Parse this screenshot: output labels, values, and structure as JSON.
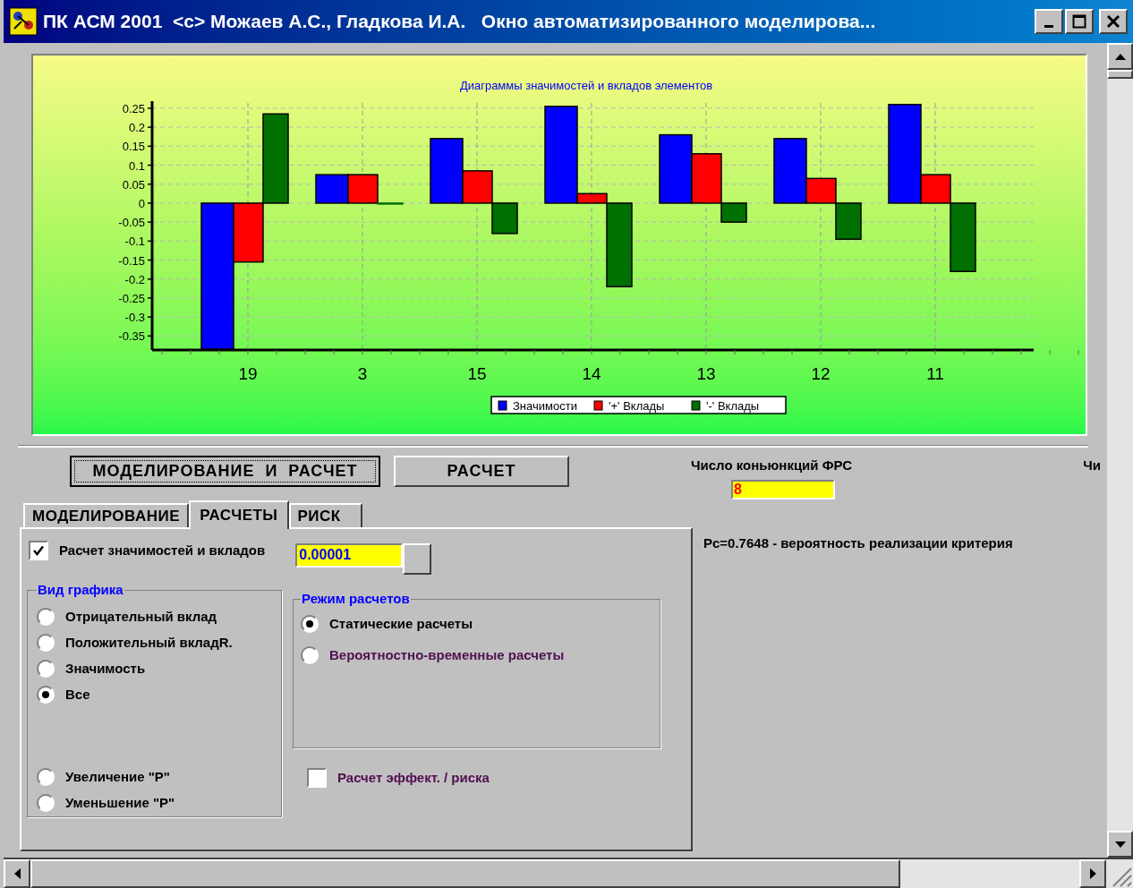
{
  "window": {
    "title": "ПК АСМ 2001  <c> Можаев А.С., Гладкова И.А.   Окно автоматизированного моделирова..."
  },
  "chart": {
    "chart_data": {
      "type": "bar",
      "title": "Диаграммы значимостей и вкладов элементов",
      "categories": [
        "19",
        "3",
        "15",
        "14",
        "13",
        "12",
        "11"
      ],
      "series": [
        {
          "name": "Значимости",
          "color": "#0000ff",
          "values": [
            -0.385,
            0.075,
            0.17,
            0.255,
            0.18,
            0.17,
            0.26
          ]
        },
        {
          "name": "'+' Вклады",
          "color": "#ff0000",
          "values": [
            -0.155,
            0.075,
            0.085,
            0.025,
            0.13,
            0.065,
            0.075
          ]
        },
        {
          "name": "'-' Вклады",
          "color": "#007000",
          "values": [
            0.235,
            0,
            -0.08,
            -0.22,
            -0.05,
            -0.095,
            -0.18
          ]
        }
      ],
      "grid": true,
      "legend": true,
      "ylim": [
        -0.387,
        0.264
      ],
      "yticks": [
        0.25,
        0.2,
        0.15,
        0.1,
        0.05,
        0,
        -0.05,
        -0.1,
        -0.15,
        -0.2,
        -0.25,
        -0.3,
        -0.35
      ]
    }
  },
  "buttons": [
    {
      "label": "МОДЕЛИРОВАНИЕ  И  РАСЧЕТ",
      "focused": true
    },
    {
      "label": "РАСЧЕТ",
      "focused": false
    }
  ],
  "conjunctions": {
    "label": "Число коньюнкций ФРС",
    "value": "8"
  },
  "cut_label": "Чи",
  "tabs": [
    {
      "label": "МОДЕЛИРОВАНИЕ",
      "selected": false
    },
    {
      "label": "РАСЧЕТЫ",
      "selected": true
    },
    {
      "label": "РИСК",
      "selected": false
    }
  ],
  "calc_checkbox": {
    "label": "Расчет значимостей и вкладов",
    "checked": true
  },
  "threshold": {
    "value": "0.00001"
  },
  "graph_type": {
    "title": "Вид графика",
    "options": [
      {
        "label": "Отрицательный вклад",
        "selected": false
      },
      {
        "label": "Положительный вкладR.",
        "selected": false
      },
      {
        "label": "Значимость",
        "selected": false
      },
      {
        "label": "Все",
        "selected": true
      }
    ],
    "scale_options": [
      {
        "label": "Увеличение \"Р\"",
        "selected": false
      },
      {
        "label": "Уменьшение \"Р\"",
        "selected": false
      }
    ]
  },
  "calc_mode": {
    "title": "Режим расчетов",
    "options": [
      {
        "label": "Статические расчеты",
        "selected": true,
        "color": "#000000"
      },
      {
        "label": "Вероятностно-временные расчеты",
        "selected": false,
        "color": "#501050"
      }
    ]
  },
  "risk_checkbox": {
    "label": "Расчет эффект. / риска",
    "checked": false
  },
  "result": "Рс=0.7648 - вероятность реализации критерия"
}
